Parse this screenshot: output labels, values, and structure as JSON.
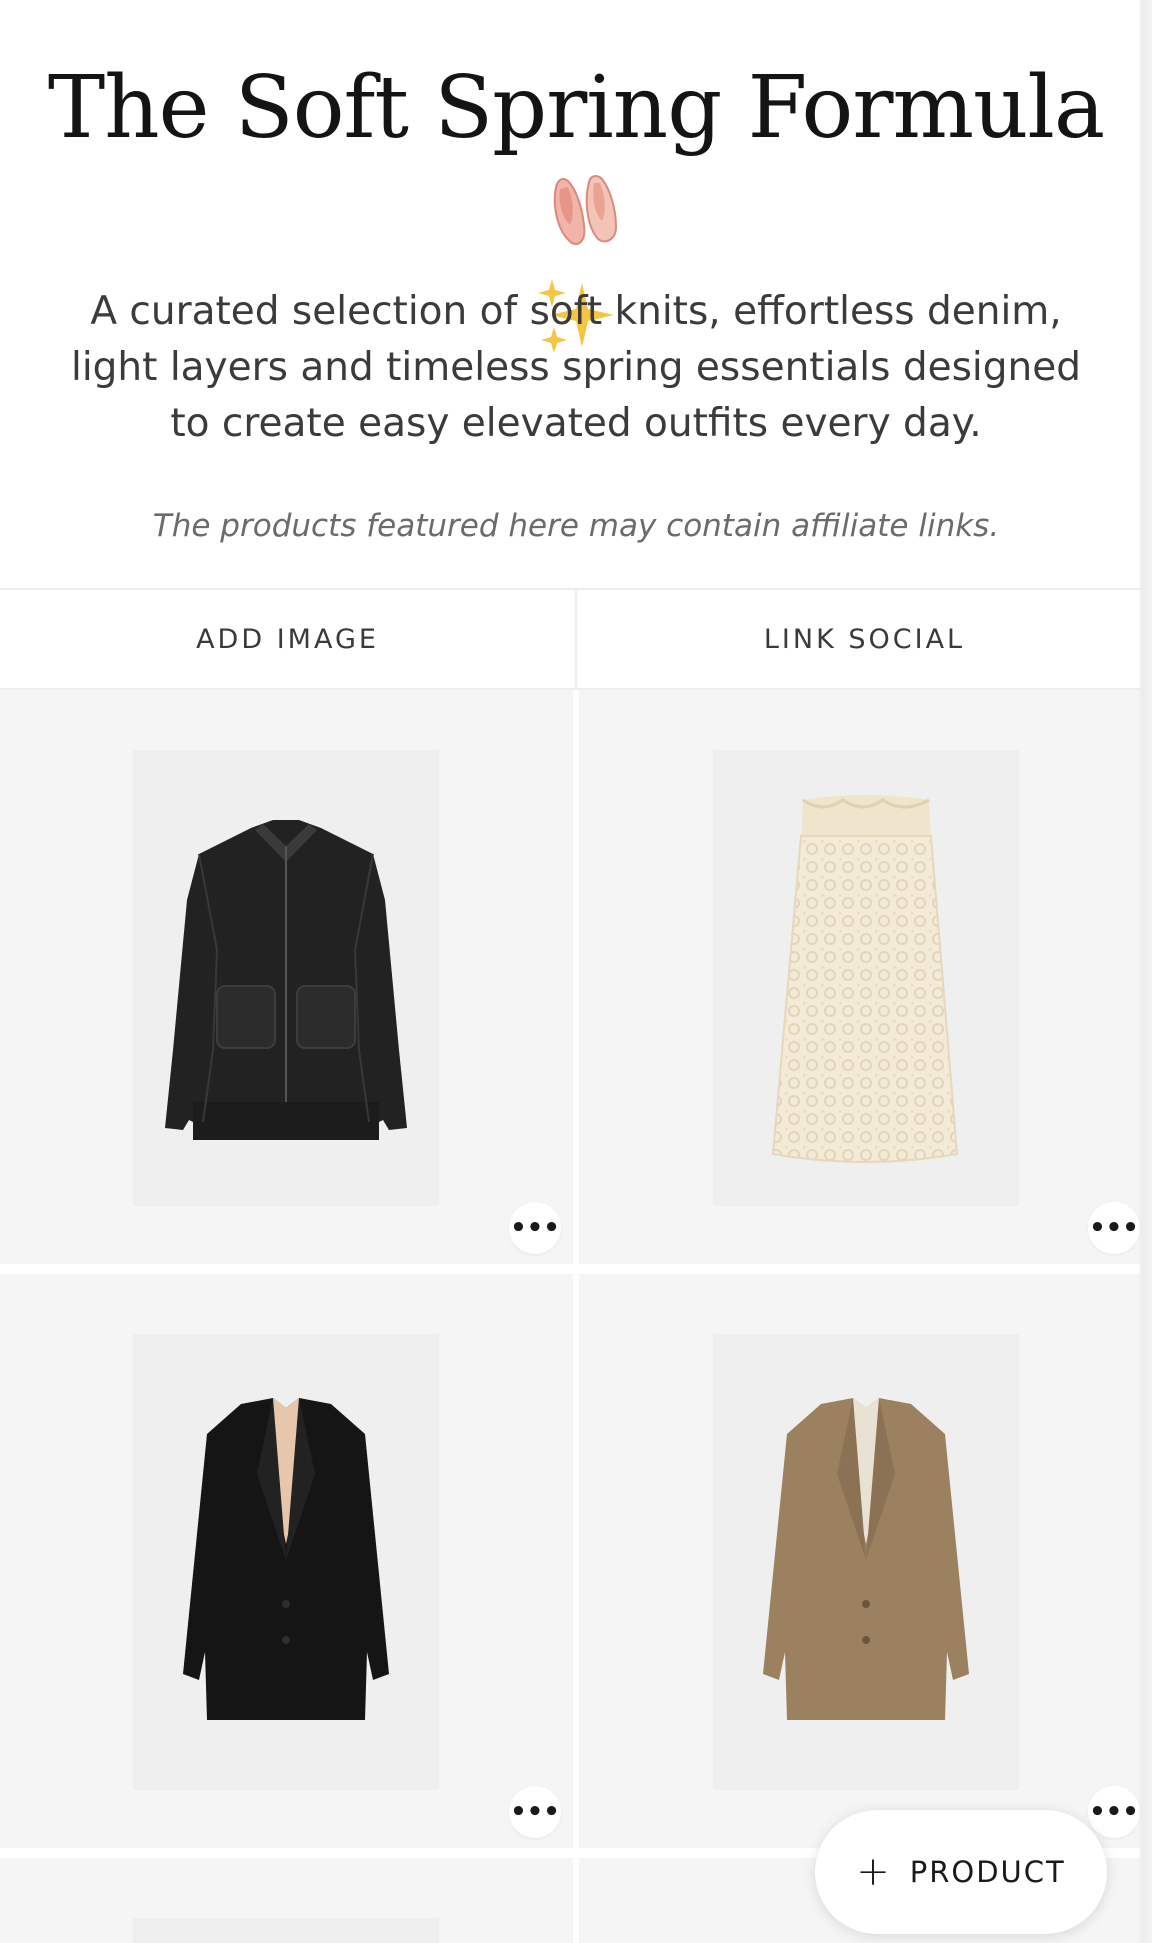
{
  "header": {
    "title_line1": "The Soft Spring Formula",
    "title_emoji1_icon": "ballet-shoes-icon",
    "title_emoji2_icon": "sparkles-icon",
    "description": "A curated selection of soft knits, effortless denim, light layers and timeless spring essentials designed to create easy elevated outfits every day.",
    "disclaimer": "The products featured here may contain affiliate links."
  },
  "tabs": [
    {
      "label": "ADD IMAGE"
    },
    {
      "label": "LINK SOCIAL"
    }
  ],
  "products": [
    {
      "item": "black leather jacket",
      "more_icon": "more-dots-icon"
    },
    {
      "item": "cream lace skirt",
      "more_icon": "more-dots-icon"
    },
    {
      "item": "black blazer",
      "more_icon": "more-dots-icon"
    },
    {
      "item": "camel blazer",
      "more_icon": "more-dots-icon"
    }
  ],
  "fab": {
    "icon": "plus-icon",
    "label": "PRODUCT"
  },
  "colors": {
    "card_bg": "#f5f5f5",
    "image_bg": "#efefef",
    "text": "#2b2b2b"
  }
}
